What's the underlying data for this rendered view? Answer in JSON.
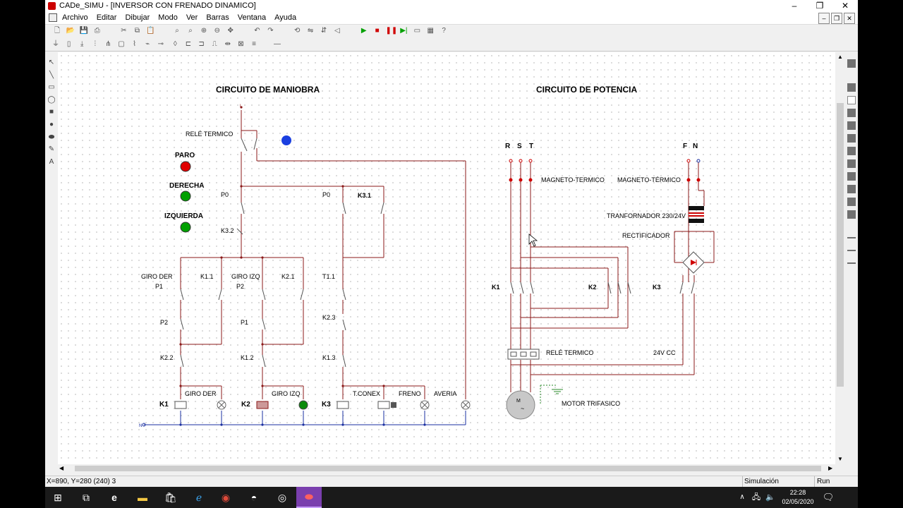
{
  "window": {
    "title": "CADe_SIMU - [INVERSOR CON FRENADO DINAMICO]",
    "minimize": "–",
    "maximize": "❐",
    "close": "✕"
  },
  "menu": [
    "Archivo",
    "Editar",
    "Dibujar",
    "Modo",
    "Ver",
    "Barras",
    "Ventana",
    "Ayuda"
  ],
  "mdi": {
    "minimize": "–",
    "restore": "❐",
    "close": "✕"
  },
  "toolbar1": [
    {
      "name": "new-icon",
      "glyph": "🗋"
    },
    {
      "name": "open-icon",
      "glyph": "📂"
    },
    {
      "name": "save-icon",
      "glyph": "💾"
    },
    {
      "name": "print-icon",
      "glyph": "⎙"
    },
    {
      "name": "cut-icon",
      "glyph": "✂"
    },
    {
      "name": "copy-icon",
      "glyph": "⧉"
    },
    {
      "name": "paste-icon",
      "glyph": "📋"
    },
    {
      "name": "zoom-fit-icon",
      "glyph": "⌕"
    },
    {
      "name": "zoom-window-icon",
      "glyph": "⌕"
    },
    {
      "name": "zoom-in-icon",
      "glyph": "⊕"
    },
    {
      "name": "zoom-out-icon",
      "glyph": "⊖"
    },
    {
      "name": "pan-icon",
      "glyph": "✥"
    },
    {
      "name": "undo-icon",
      "glyph": "↶"
    },
    {
      "name": "redo-icon",
      "glyph": "↷"
    },
    {
      "name": "rotate-icon",
      "glyph": "⟲"
    },
    {
      "name": "mirror-icon",
      "glyph": "⇋"
    },
    {
      "name": "flip-icon",
      "glyph": "⇵"
    },
    {
      "name": "align-icon",
      "glyph": "◁"
    },
    {
      "name": "run-icon",
      "glyph": "▶",
      "color": "#00a000"
    },
    {
      "name": "stop-icon",
      "glyph": "■",
      "color": "#d00000"
    },
    {
      "name": "pause-icon",
      "glyph": "❚❚",
      "color": "#d00000"
    },
    {
      "name": "step-icon",
      "glyph": "▶|",
      "color": "#00a000"
    },
    {
      "name": "window-icon",
      "glyph": "▭"
    },
    {
      "name": "grid-icon",
      "glyph": "▦"
    },
    {
      "name": "help-icon",
      "glyph": "?"
    }
  ],
  "toolbar2": [
    "power-supply-icon",
    "fuse-icon",
    "breaker-icon",
    "three-pole-icon",
    "motor-icon",
    "relay-icon",
    "contact-icon",
    "switch-icon",
    "sensor-icon",
    "lamp-icon",
    "coil-icon",
    "timer-icon",
    "terminal-icon",
    "plc-icon",
    "connector-icon",
    "wire-icon"
  ],
  "lefttools": [
    "pointer-icon",
    "line-icon",
    "rectangle-icon",
    "ellipse-icon",
    "filled-rectangle-icon",
    "filled-ellipse-icon",
    "fill-icon",
    "eraser-icon",
    "text-icon"
  ],
  "diagram": {
    "title_control": "CIRCUITO DE MANIOBRA",
    "title_power": "CIRCUITO DE POTENCIA",
    "lamp_colors": {
      "paro": "#e00000",
      "derecha": "#00a000",
      "izquierda": "#00a000",
      "indicator": "#1a3fe0"
    },
    "lamps": [
      {
        "id": "paro",
        "label": "PARO"
      },
      {
        "id": "derecha",
        "label": "DERECHA"
      },
      {
        "id": "izquierda",
        "label": "IZQUIERDA"
      }
    ],
    "control_labels": {
      "top_l": "L",
      "bottom_n": "N",
      "rele": "RELÉ TERMICO",
      "p0a": "P0",
      "p0b": "P0",
      "k31": "K3.1",
      "k32": "K3.2",
      "giroder": "GIRO DER",
      "p1a": "P1",
      "k11": "K1.1",
      "giroizq": "GIRO IZQ",
      "p2a": "P2",
      "k21": "K2.1",
      "t11": "T1.1",
      "p2b": "P2",
      "p1b": "P1",
      "k23": "K2.3",
      "k22": "K2.2",
      "k12": "K1.2",
      "k13": "K1.3",
      "k1": "K1",
      "k2": "K2",
      "k3": "K3",
      "giroder_lamp": "GIRO DER",
      "giroizq_lamp": "GIRO IZQ",
      "tconex": "T.CONEX",
      "freno": "FRENO",
      "averia": "AVERIA"
    },
    "power_labels": {
      "r": "R",
      "s": "S",
      "t": "T",
      "f": "F",
      "n": "N",
      "magneto1": "MAGNETO-TERMICO",
      "magneto2": "MAGNETO-TÉRMICO",
      "trafo": "TRANFORNADOR 230/24V",
      "rect": "RECTIFICADOR",
      "k1": "K1",
      "k2": "K2",
      "k3": "K3",
      "rele": "RELÉ TERMICO",
      "dc": "24V CC",
      "motor": "MOTOR TRIFASICO"
    }
  },
  "status": {
    "coords": "X=890, Y=280 (240) 3",
    "mode": "Simulación",
    "state": "Run"
  },
  "taskbar": {
    "time": "22:28",
    "date": "02/05/2020"
  }
}
